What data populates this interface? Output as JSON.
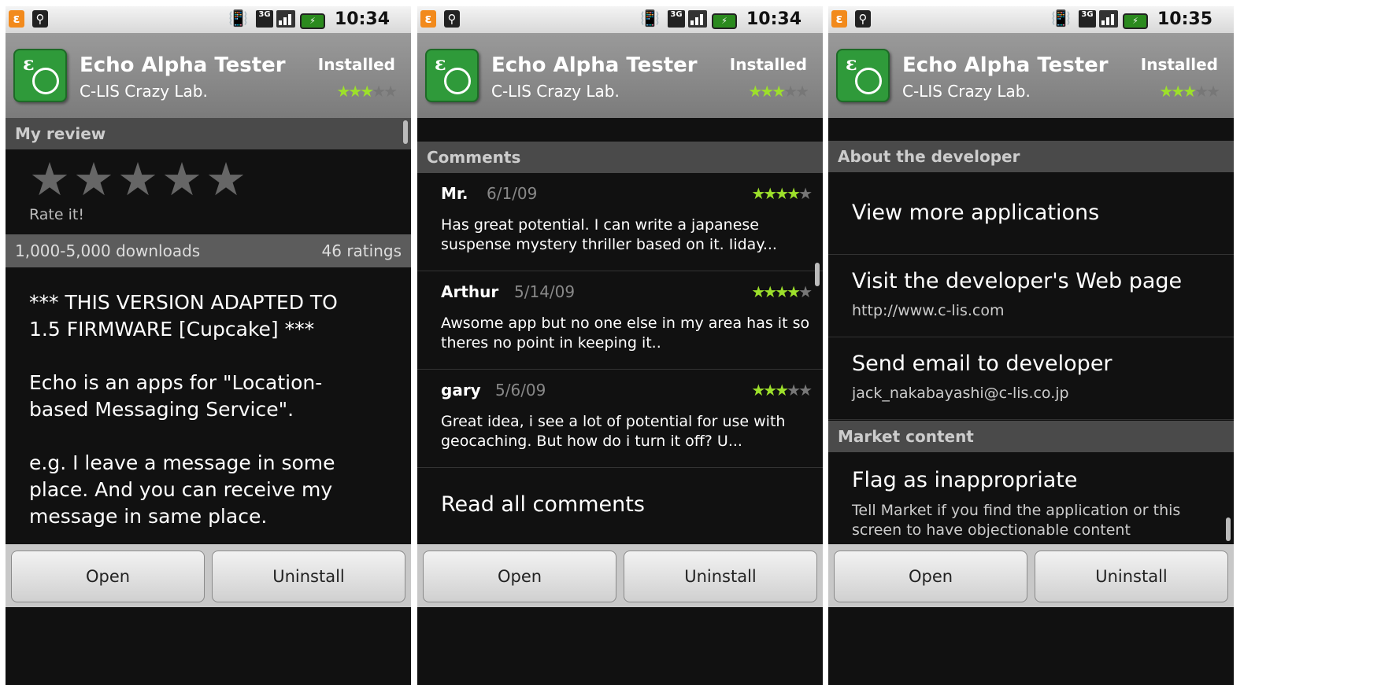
{
  "status": {
    "echo_icon": "ε",
    "usb_icon": "usb-icon",
    "net": "3G",
    "times": [
      "10:34",
      "10:34",
      "10:35"
    ]
  },
  "app": {
    "title": "Echo Alpha Tester",
    "developer": "C-LIS Crazy Lab.",
    "status": "Installed",
    "rating_stars": 3,
    "total_stars": 5
  },
  "panel1": {
    "section": "My review",
    "rate_label": "Rate it!",
    "downloads": "1,000-5,000 downloads",
    "ratings": "46 ratings",
    "description": "*** THIS VERSION ADAPTED TO\n1.5 FIRMWARE [Cupcake] ***\n\nEcho is an apps for \"Location-\nbased Messaging Service\".\n\ne.g. I leave a message in some\nplace. And you can receive my\nmessage in same place."
  },
  "panel2": {
    "section": "Comments",
    "comments": [
      {
        "name": "Mr.",
        "date": "6/1/09",
        "stars": 4,
        "text": "Has great potential.  I can write a japanese suspense mystery thriller based on it.  Iiday..."
      },
      {
        "name": "Arthur",
        "date": "5/14/09",
        "stars": 4,
        "text": "Awsome app but no one else in my area has it so theres no point in keeping it.."
      },
      {
        "name": "gary",
        "date": "5/6/09",
        "stars": 3,
        "text": "Great idea, i see a lot of potential for use with geocaching. But how do i turn it off? U..."
      }
    ],
    "read_all": "Read all comments"
  },
  "panel3": {
    "section_dev": "About the developer",
    "view_more": "View more applications",
    "visit_web": "Visit the developer's Web page",
    "web_url": "http://www.c-lis.com",
    "send_email": "Send email to developer",
    "email": "jack_nakabayashi@c-lis.co.jp",
    "section_market": "Market content",
    "flag": "Flag as inappropriate",
    "flag_desc": "Tell Market if you find the application or this screen to have objectionable content"
  },
  "buttons": {
    "open": "Open",
    "uninstall": "Uninstall"
  },
  "colors": {
    "star_on": "#9de02b",
    "star_off": "#777777",
    "header_bg": "#8a8a8a",
    "app_icon": "#2f9a3a"
  }
}
